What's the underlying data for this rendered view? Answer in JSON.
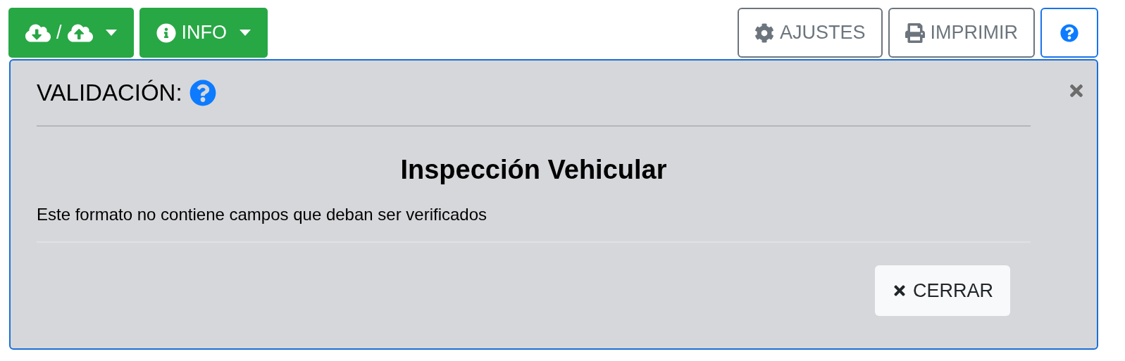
{
  "toolbar": {
    "left": [
      {
        "kind": "transfer",
        "label": "/"
      },
      {
        "kind": "info",
        "label": "INFO"
      }
    ],
    "right": [
      {
        "kind": "settings",
        "label": "AJUSTES"
      },
      {
        "kind": "print",
        "label": "IMPRIMIR"
      },
      {
        "kind": "help"
      }
    ]
  },
  "panel": {
    "title": "VALIDACIÓN:",
    "heading": "Inspección Vehicular",
    "message": "Este formato no contiene campos que deban ser verificados",
    "close_button": "CERRAR"
  }
}
